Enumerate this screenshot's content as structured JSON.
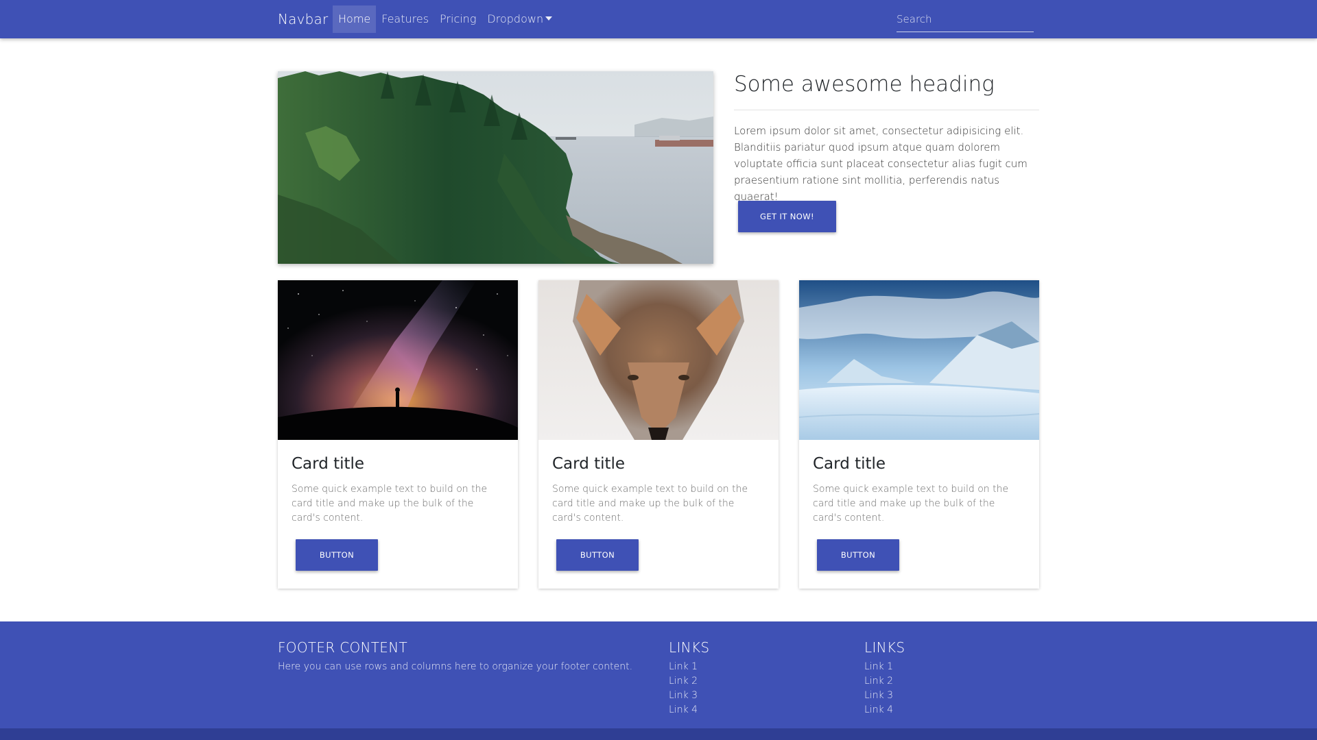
{
  "navbar": {
    "brand": "Navbar",
    "items": [
      {
        "label": "Home",
        "active": true
      },
      {
        "label": "Features",
        "active": false
      },
      {
        "label": "Pricing",
        "active": false
      },
      {
        "label": "Dropdown",
        "active": false,
        "has_caret": true
      }
    ],
    "search_placeholder": "Search"
  },
  "hero": {
    "heading": "Some awesome heading",
    "paragraph": "Lorem ipsum dolor sit amet, consectetur adipisicing elit. Blanditiis pariatur quod ipsum atque quam dolorem voluptate officia sunt placeat consectetur alias fugit cum praesentium ratione sint mollitia, perferendis natus quaerat!",
    "button_label": "GET IT NOW!",
    "image": "forest-coastline-photo"
  },
  "cards": [
    {
      "title": "Card title",
      "text": "Some quick example text to build on the card title and make up the bulk of the card's content.",
      "button_label": "BUTTON",
      "image": "milky-way-night-sky-photo"
    },
    {
      "title": "Card title",
      "text": "Some quick example text to build on the card title and make up the bulk of the card's content.",
      "button_label": "BUTTON",
      "image": "coyote-in-snow-photo"
    },
    {
      "title": "Card title",
      "text": "Some quick example text to build on the card title and make up the bulk of the card's content.",
      "button_label": "BUTTON",
      "image": "snowy-mountain-photo"
    }
  ],
  "footer": {
    "content_heading": "FOOTER CONTENT",
    "content_text": "Here you can use rows and columns here to organize your footer content.",
    "link_columns": [
      {
        "heading": "LINKS",
        "links": [
          "Link 1",
          "Link 2",
          "Link 3",
          "Link 4"
        ]
      },
      {
        "heading": "LINKS",
        "links": [
          "Link 1",
          "Link 2",
          "Link 3",
          "Link 4"
        ]
      }
    ]
  },
  "colors": {
    "primary": "#3f51b5",
    "footer_bottom": "#2f3e94",
    "text": "#212529",
    "muted_text": "#6c6c6c"
  }
}
